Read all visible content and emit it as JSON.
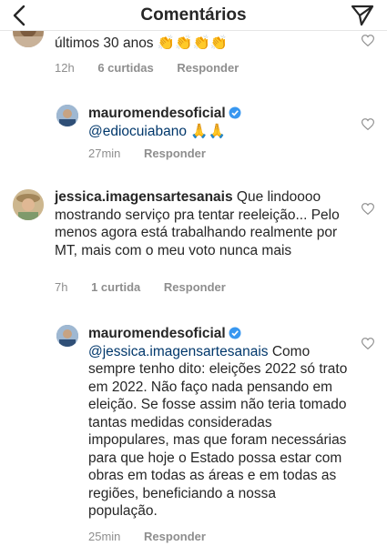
{
  "header": {
    "title": "Comentários",
    "back_icon": "chevron-left-icon",
    "send_icon": "paper-plane-icon"
  },
  "comments": [
    {
      "text": "últimos 30 anos 👏👏👏👏",
      "time": "12h",
      "likes": "6 curtidas",
      "reply": "Responder"
    },
    {
      "username": "mauromendesoficial",
      "verified": true,
      "mention": "@ediocuiabano",
      "text": " 🙏🙏",
      "time": "27min",
      "reply": "Responder"
    },
    {
      "username": "jessica.imagensartesanais",
      "text": " Que lindoooo mostrando serviço pra tentar reeleição... Pelo menos agora está trabalhando realmente por MT, mais com o meu voto nunca mais",
      "time": "7h",
      "likes": "1 curtida",
      "reply": "Responder"
    },
    {
      "username": "mauromendesoficial",
      "verified": true,
      "mention": "@jessica.imagensartesanais",
      "text": " Como sempre tenho dito: eleições 2022 só trato em 2022. Não faço nada pensando em eleição. Se fosse assim não teria tomado tantas medidas consideradas impopulares, mas que foram necessárias para que hoje o Estado possa estar com obras em todas as áreas e em todas as regiões, beneficiando a nossa população.",
      "time": "25min",
      "reply": "Responder"
    }
  ],
  "colors": {
    "text": "#262626",
    "meta": "#8e8e8e",
    "mention": "#00376b",
    "verified": "#3897f0"
  }
}
